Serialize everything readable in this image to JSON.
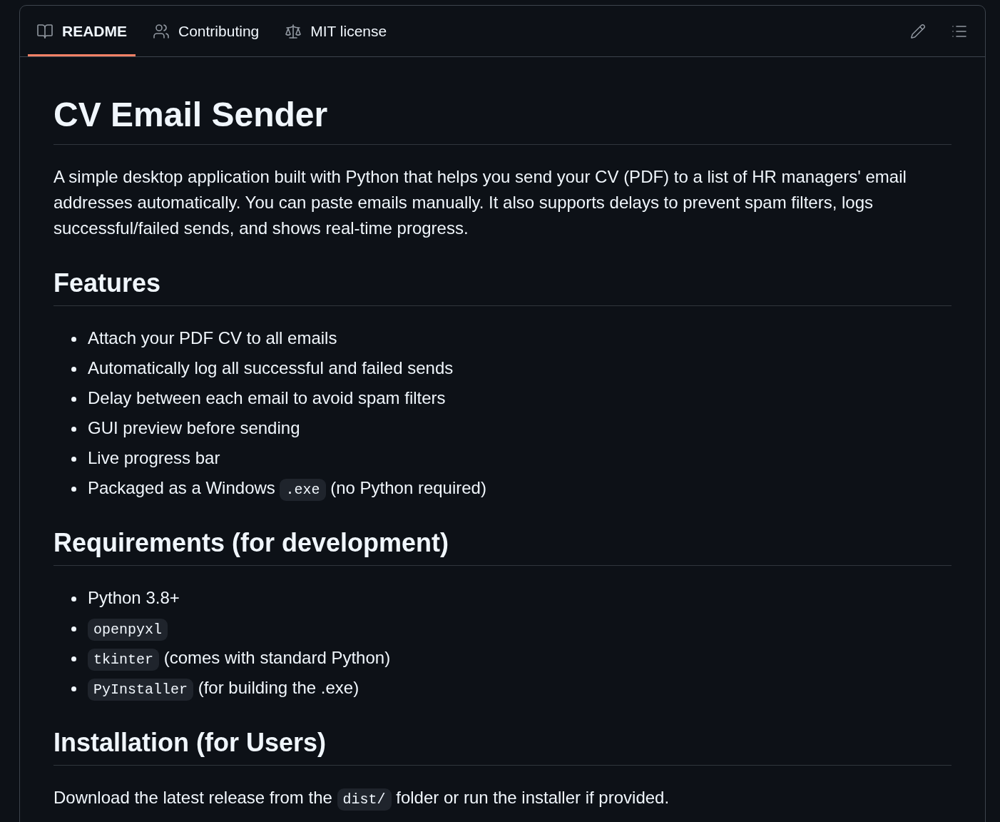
{
  "tabs": [
    {
      "kind": "readme",
      "label": "README",
      "selected": true
    },
    {
      "kind": "contributing",
      "label": "Contributing",
      "selected": false
    },
    {
      "kind": "license",
      "label": "MIT license",
      "selected": false
    }
  ],
  "readme": {
    "title": "CV Email Sender",
    "blocks": [
      {
        "kind": "paragraph",
        "parts": [
          {
            "kind": "text",
            "text": "A simple desktop application built with Python that helps you send your CV (PDF) to a list of HR managers' email addresses automatically. You can paste emails manually. It also supports delays to prevent spam filters, logs successful/failed sends, and shows real-time progress."
          }
        ]
      },
      {
        "kind": "heading",
        "text": "Features"
      },
      {
        "kind": "list",
        "items": [
          {
            "parts": [
              {
                "kind": "text",
                "text": "Attach your PDF CV to all emails"
              }
            ]
          },
          {
            "parts": [
              {
                "kind": "text",
                "text": "Automatically log all successful and failed sends"
              }
            ]
          },
          {
            "parts": [
              {
                "kind": "text",
                "text": "Delay between each email to avoid spam filters"
              }
            ]
          },
          {
            "parts": [
              {
                "kind": "text",
                "text": "GUI preview before sending"
              }
            ]
          },
          {
            "parts": [
              {
                "kind": "text",
                "text": "Live progress bar"
              }
            ]
          },
          {
            "parts": [
              {
                "kind": "text",
                "text": "Packaged as a Windows "
              },
              {
                "kind": "code",
                "text": ".exe"
              },
              {
                "kind": "text",
                "text": " (no Python required)"
              }
            ]
          }
        ]
      },
      {
        "kind": "heading",
        "text": "Requirements (for development)"
      },
      {
        "kind": "list",
        "items": [
          {
            "parts": [
              {
                "kind": "text",
                "text": "Python 3.8+"
              }
            ]
          },
          {
            "parts": [
              {
                "kind": "code",
                "text": "openpyxl"
              }
            ]
          },
          {
            "parts": [
              {
                "kind": "code",
                "text": "tkinter"
              },
              {
                "kind": "text",
                "text": " (comes with standard Python)"
              }
            ]
          },
          {
            "parts": [
              {
                "kind": "code",
                "text": "PyInstaller"
              },
              {
                "kind": "text",
                "text": " (for building the .exe)"
              }
            ]
          }
        ]
      },
      {
        "kind": "heading",
        "text": "Installation (for Users)"
      },
      {
        "kind": "paragraph",
        "parts": [
          {
            "kind": "text",
            "text": "Download the latest release from the "
          },
          {
            "kind": "code",
            "text": "dist/"
          },
          {
            "kind": "text",
            "text": " folder or run the installer if provided."
          }
        ]
      }
    ]
  }
}
